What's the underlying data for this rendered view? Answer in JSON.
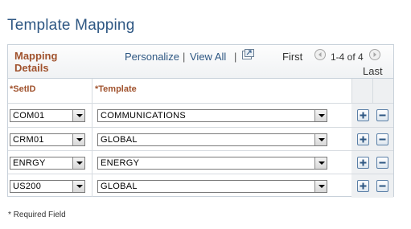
{
  "page": {
    "title": "Template Mapping"
  },
  "grid": {
    "title": "Mapping Details",
    "nav": {
      "personalize": "Personalize",
      "separator": "|",
      "view_all": "View All",
      "zoom_icon": "zoom-icon",
      "first": "First",
      "range": "1-4 of 4",
      "last": "Last"
    },
    "columns": {
      "setid": "*SetID",
      "template": "*Template"
    },
    "rows": [
      {
        "setid": "COM01",
        "template": "COMMUNICATIONS"
      },
      {
        "setid": "CRM01",
        "template": "GLOBAL"
      },
      {
        "setid": "ENRGY",
        "template": "ENERGY"
      },
      {
        "setid": "US200",
        "template": "GLOBAL"
      }
    ]
  },
  "footer": {
    "required_note": "* Required Field"
  },
  "colors": {
    "title": "#2e5783",
    "grid_title": "#a0522d",
    "link": "#2e5783",
    "button_border": "#5a7fa7"
  }
}
